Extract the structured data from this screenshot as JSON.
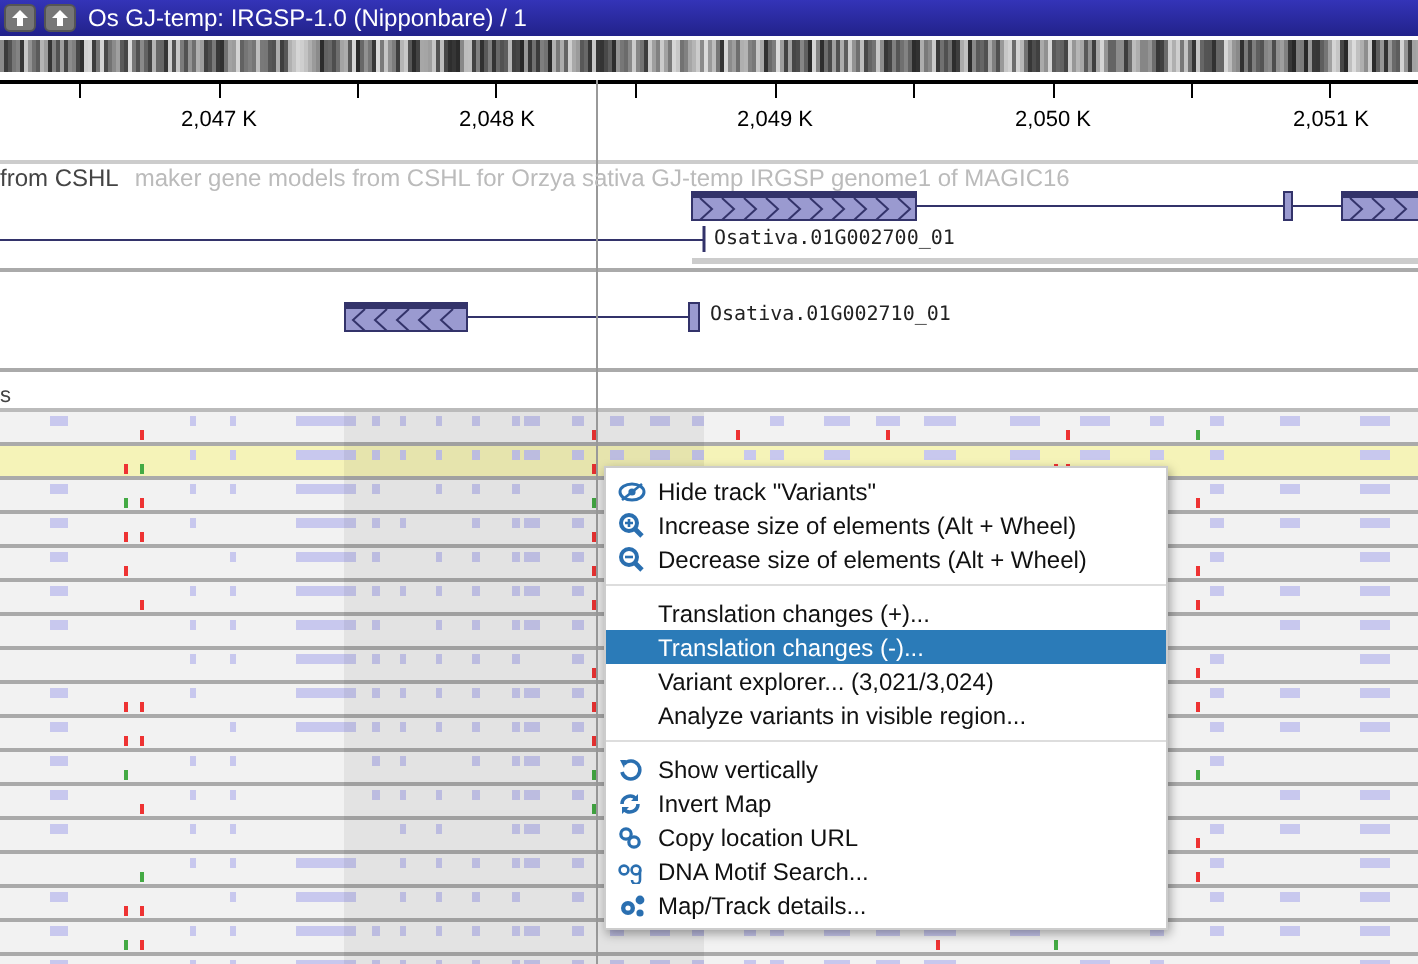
{
  "title_bar": {
    "title": "Os GJ-temp: IRGSP-1.0 (Nipponbare) / 1"
  },
  "ruler": {
    "ticks": [
      "2,047 K",
      "2,048 K",
      "2,049 K",
      "2,050 K",
      "2,051 K"
    ]
  },
  "gene_tracks": [
    {
      "label": "from CSHL",
      "description": "maker gene models from CSHL for Orzya sativa GJ-temp IRGSP genome1 of MAGIC16",
      "gene_name": "Osativa.01G002700_01"
    },
    {
      "gene_name": "Osativa.01G002710_01"
    }
  ],
  "variant_track": {
    "label": "s",
    "rows": [
      {
        "highlighted": false
      },
      {
        "highlighted": true
      },
      {
        "highlighted": false
      },
      {
        "highlighted": false
      },
      {
        "highlighted": false
      },
      {
        "highlighted": false
      },
      {
        "highlighted": false
      },
      {
        "highlighted": false
      },
      {
        "highlighted": false
      },
      {
        "highlighted": false
      },
      {
        "highlighted": false
      },
      {
        "highlighted": false
      },
      {
        "highlighted": false
      },
      {
        "highlighted": false
      },
      {
        "highlighted": false
      },
      {
        "highlighted": false
      },
      {
        "highlighted": false
      }
    ]
  },
  "context_menu": {
    "items": [
      {
        "kind": "item",
        "label": "Hide track \"Variants\"",
        "selected": false
      },
      {
        "kind": "item",
        "label": "Increase size of elements (Alt + Wheel)",
        "selected": false
      },
      {
        "kind": "item",
        "label": "Decrease size of elements (Alt + Wheel)",
        "selected": false
      },
      {
        "kind": "separator"
      },
      {
        "kind": "item",
        "label": "Translation changes (+)...",
        "selected": false
      },
      {
        "kind": "item",
        "label": "Translation changes (-)...",
        "selected": true
      },
      {
        "kind": "item",
        "label": "Variant explorer... (3,021/3,024)",
        "selected": false
      },
      {
        "kind": "item",
        "label": "Analyze variants in visible region...",
        "selected": false
      },
      {
        "kind": "separator"
      },
      {
        "kind": "item",
        "label": "Show vertically",
        "selected": false
      },
      {
        "kind": "item",
        "label": "Invert Map",
        "selected": false
      },
      {
        "kind": "item",
        "label": "Copy location URL",
        "selected": false
      },
      {
        "kind": "item",
        "label": "DNA Motif Search...",
        "selected": false
      },
      {
        "kind": "item",
        "label": "Map/Track details...",
        "selected": false
      }
    ]
  }
}
